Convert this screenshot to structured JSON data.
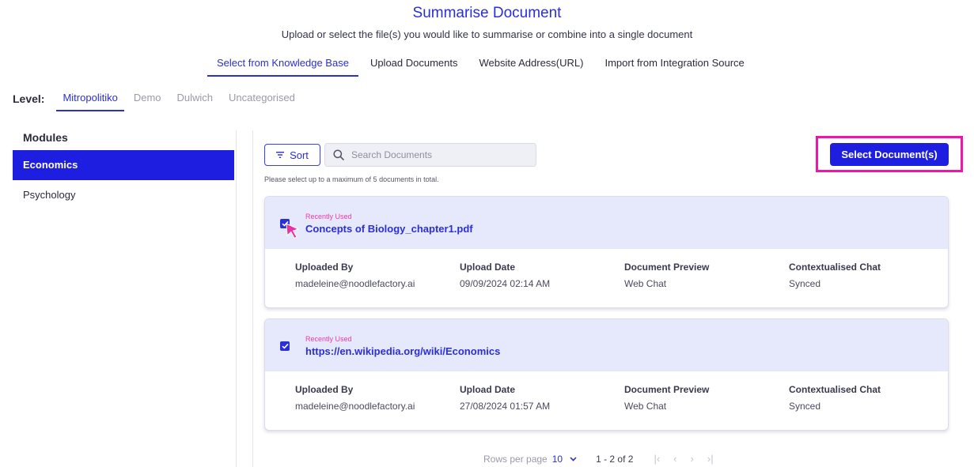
{
  "header": {
    "title": "Summarise Document",
    "subtitle": "Upload or select the file(s) you would like to summarise or combine into a single document"
  },
  "tabs": [
    {
      "label": "Select from Knowledge Base",
      "active": true
    },
    {
      "label": "Upload Documents",
      "active": false
    },
    {
      "label": "Website Address(URL)",
      "active": false
    },
    {
      "label": "Import from Integration Source",
      "active": false
    }
  ],
  "level": {
    "label": "Level:",
    "options": [
      "Mitropolitiko",
      "Demo",
      "Dulwich",
      "Uncategorised"
    ],
    "selected": "Mitropolitiko"
  },
  "modules": {
    "title": "Modules",
    "items": [
      {
        "label": "Economics",
        "active": true
      },
      {
        "label": "Psychology",
        "active": false
      }
    ]
  },
  "toolbar": {
    "sort_label": "Sort",
    "search_placeholder": "Search Documents",
    "hint": "Please select up to a maximum of 5 documents in total.",
    "select_button": "Select Document(s)"
  },
  "documents": [
    {
      "tag": "Recently Used",
      "name": "Concepts of Biology_chapter1.pdf",
      "checked": true,
      "fields": [
        {
          "label": "Uploaded By",
          "value": "madeleine@noodlefactory.ai"
        },
        {
          "label": "Upload Date",
          "value": "09/09/2024 02:14 AM"
        },
        {
          "label": "Document Preview",
          "value": "Web Chat"
        },
        {
          "label": "Contextualised Chat",
          "value": "Synced"
        }
      ]
    },
    {
      "tag": "Recently Used",
      "name": "https://en.wikipedia.org/wiki/Economics",
      "checked": true,
      "fields": [
        {
          "label": "Uploaded By",
          "value": "madeleine@noodlefactory.ai"
        },
        {
          "label": "Upload Date",
          "value": "27/08/2024 01:57 AM"
        },
        {
          "label": "Document Preview",
          "value": "Web Chat"
        },
        {
          "label": "Contextualised Chat",
          "value": "Synced"
        }
      ]
    }
  ],
  "pagination": {
    "rows_label": "Rows per page",
    "rows_value": "10",
    "range": "1 - 2 of 2"
  },
  "colors": {
    "accent": "#2a2fd6",
    "primary_button": "#1e1ee0",
    "highlight": "#f014a8",
    "recent_tag": "#ec3aa8",
    "card_header": "#e6e9fb"
  }
}
